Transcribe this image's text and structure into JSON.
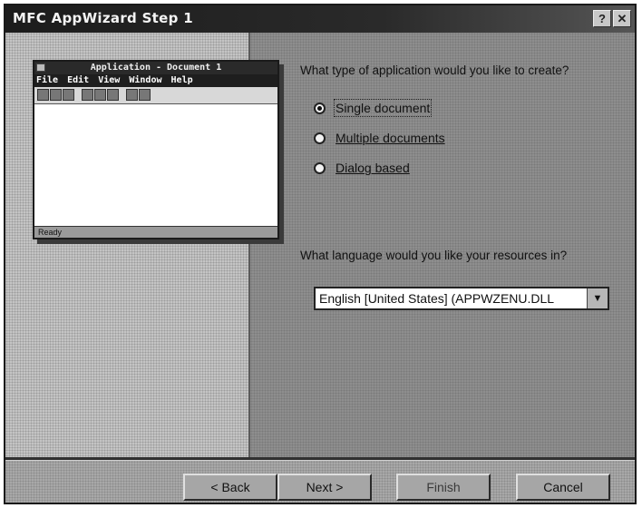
{
  "window": {
    "title": "MFC AppWizard  Step 1",
    "help_glyph": "?",
    "close_glyph": "✕"
  },
  "preview": {
    "title": "Application - Document 1",
    "menu": [
      "File",
      "Edit",
      "View",
      "Window",
      "Help"
    ],
    "status": "Ready"
  },
  "app_type": {
    "question": "What type of application would you like to create?",
    "options": [
      {
        "label": "Single document",
        "selected": true
      },
      {
        "label": "Multiple documents",
        "selected": false
      },
      {
        "label": "Dialog based",
        "selected": false
      }
    ]
  },
  "language": {
    "question": "What language would you like your resources in?",
    "selected": "English [United States] (APPWZENU.DLL",
    "dropdown_icon": "▼"
  },
  "buttons": {
    "back": "< Back",
    "next": "Next >",
    "finish": "Finish",
    "cancel": "Cancel"
  }
}
